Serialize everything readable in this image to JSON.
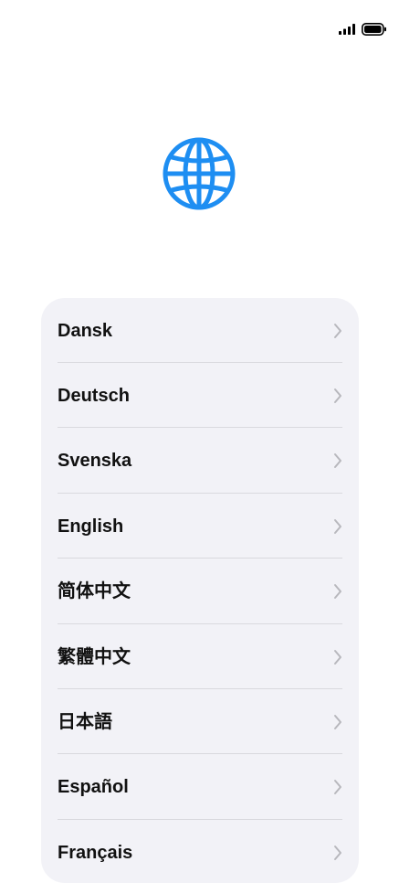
{
  "status_bar": {
    "signal_icon": "cellular-signal-icon",
    "battery_icon": "battery-icon"
  },
  "hero": {
    "icon": "globe-icon",
    "accent_color": "#1e8ef2"
  },
  "languages": [
    "Dansk",
    "Deutsch",
    "Svenska",
    "English",
    "简体中文",
    "繁體中文",
    "日本語",
    "Español",
    "Français"
  ],
  "row_icon": "chevron-right-icon",
  "colors": {
    "background": "#ffffff",
    "card": "#f2f2f7",
    "divider": "#d9d9de",
    "chevron": "#b8b8bd",
    "text": "#111111"
  }
}
